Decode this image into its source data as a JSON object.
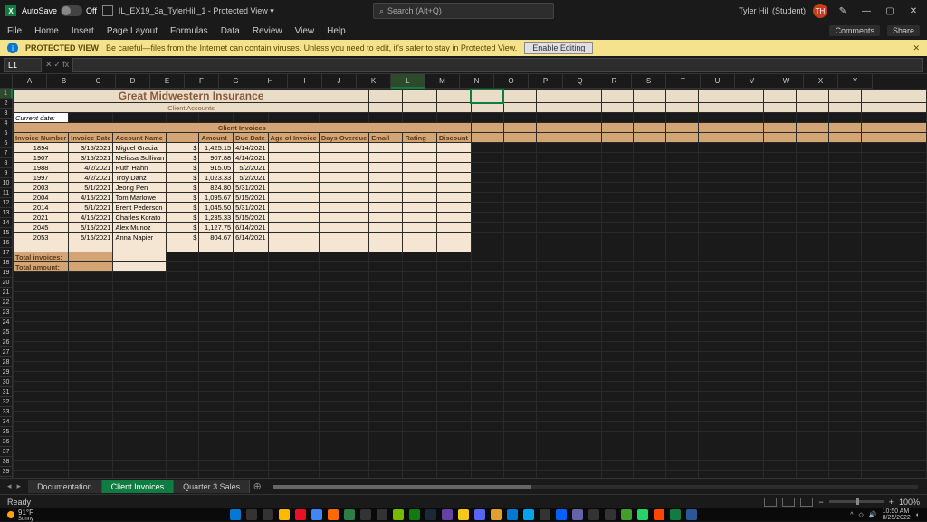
{
  "titlebar": {
    "autosave_label": "AutoSave",
    "autosave_state": "Off",
    "doc_title": "IL_EX19_3a_TylerHill_1 - Protected View ▾",
    "search_placeholder": "Search (Alt+Q)",
    "user_name": "Tyler Hill (Student)",
    "user_initials": "TH"
  },
  "ribbon": {
    "tabs": [
      "File",
      "Home",
      "Insert",
      "Page Layout",
      "Formulas",
      "Data",
      "Review",
      "View",
      "Help"
    ],
    "comments": "Comments",
    "share": "Share"
  },
  "protected_view": {
    "title": "PROTECTED VIEW",
    "msg": "Be careful—files from the Internet can contain viruses. Unless you need to edit, it's safer to stay in Protected View.",
    "enable": "Enable Editing"
  },
  "formula": {
    "cell_ref": "L1",
    "fx": "fx"
  },
  "columns": [
    "A",
    "B",
    "C",
    "D",
    "E",
    "F",
    "G",
    "H",
    "I",
    "J",
    "K",
    "L",
    "M",
    "N",
    "O",
    "P",
    "Q",
    "R",
    "S",
    "T",
    "U",
    "V",
    "W",
    "X",
    "Y"
  ],
  "selected_col": "L",
  "selected_row": 1,
  "row_count": 40,
  "sheet": {
    "title": "Great Midwestern Insurance",
    "subtitle": "Client Accounts",
    "current_date_label": "Current date:",
    "section": "Client Invoices",
    "headers": [
      "Invoice Number",
      "Invoice Date",
      "Account Name",
      "",
      "Amount",
      "Due Date",
      "Age of Invoice",
      "Days Overdue",
      "Email",
      "Rating",
      "Discount"
    ],
    "rows": [
      {
        "num": "1894",
        "date": "3/15/2021",
        "name": "Miguel Gracia",
        "cur": "$",
        "amt": "1,425.15",
        "due": "4/14/2021"
      },
      {
        "num": "1907",
        "date": "3/15/2021",
        "name": "Melissa Sullivan",
        "cur": "$",
        "amt": "907.88",
        "due": "4/14/2021"
      },
      {
        "num": "1988",
        "date": "4/2/2021",
        "name": "Ruth Hahn",
        "cur": "$",
        "amt": "915.05",
        "due": "5/2/2021"
      },
      {
        "num": "1997",
        "date": "4/2/2021",
        "name": "Troy Danz",
        "cur": "$",
        "amt": "1,023.33",
        "due": "5/2/2021"
      },
      {
        "num": "2003",
        "date": "5/1/2021",
        "name": "Jeong Pen",
        "cur": "$",
        "amt": "824.80",
        "due": "5/31/2021"
      },
      {
        "num": "2004",
        "date": "4/15/2021",
        "name": "Tom Marlowe",
        "cur": "$",
        "amt": "1,095.67",
        "due": "5/15/2021"
      },
      {
        "num": "2014",
        "date": "5/1/2021",
        "name": "Brent Pederson",
        "cur": "$",
        "amt": "1,045.50",
        "due": "5/31/2021"
      },
      {
        "num": "2021",
        "date": "4/15/2021",
        "name": "Charles Korato",
        "cur": "$",
        "amt": "1,235.33",
        "due": "5/15/2021"
      },
      {
        "num": "2045",
        "date": "5/15/2021",
        "name": "Alex Munoz",
        "cur": "$",
        "amt": "1,127.75",
        "due": "6/14/2021"
      },
      {
        "num": "2053",
        "date": "5/15/2021",
        "name": "Anna Napier",
        "cur": "$",
        "amt": "804.67",
        "due": "6/14/2021"
      }
    ],
    "total_invoices_label": "Total invoices:",
    "total_amount_label": "Total amount:"
  },
  "tabs": {
    "list": [
      "Documentation",
      "Client Invoices",
      "Quarter 3 Sales"
    ],
    "active": 1
  },
  "status": {
    "ready": "Ready",
    "zoom": "100%"
  },
  "taskbar": {
    "temp": "91°F",
    "cond": "Sunny",
    "time": "10:50 AM",
    "date": "8/25/2022",
    "icons": [
      "#0078d4",
      "#333",
      "#333",
      "#ffb900",
      "#e81123",
      "#4285f4",
      "#ff6a00",
      "#2d7d46",
      "#333",
      "#333",
      "#76b900",
      "#107c10",
      "#1b2838",
      "#6441a5",
      "#f6c915",
      "#5865f2",
      "#e0a030",
      "#0078d4",
      "#00a4ef",
      "#333",
      "#0061ff",
      "#6264a7",
      "#333",
      "#333",
      "#40a02b",
      "#25d366",
      "#ff4500",
      "#107c41",
      "#2b579a"
    ]
  }
}
